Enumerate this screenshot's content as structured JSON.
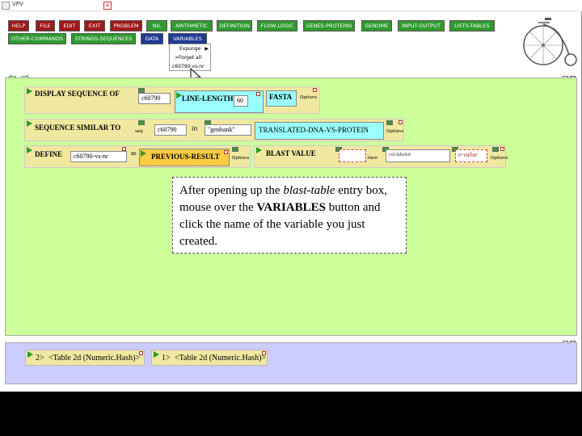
{
  "window": {
    "title": "VPV"
  },
  "menu": {
    "buttons": [
      {
        "label": "HELP",
        "color": "red"
      },
      {
        "label": "FILE",
        "color": "red"
      },
      {
        "label": "EDIT",
        "color": "red"
      },
      {
        "label": "EXIT",
        "color": "red"
      },
      {
        "label": "PROBLEM",
        "color": "red"
      },
      {
        "label": "NIL",
        "color": "green"
      },
      {
        "label": "ARITHMETIC",
        "color": "green"
      },
      {
        "label": "DEFINITION",
        "color": "green"
      },
      {
        "label": "FLOW-LOGIC",
        "color": "green"
      },
      {
        "label": "GENES-PROTEINS",
        "color": "green"
      },
      {
        "label": "GENOME",
        "color": "green"
      },
      {
        "label": "INPUT-OUTPUT",
        "color": "green"
      },
      {
        "label": "LISTS-TABLES",
        "color": "green"
      },
      {
        "label": "OTHER-COMMANDS",
        "color": "green"
      },
      {
        "label": "STRINGS-SEQUENCES",
        "color": "green"
      },
      {
        "label": "DATA",
        "color": "blue"
      },
      {
        "label": "VARIABLES",
        "color": "blue"
      }
    ],
    "colors": {
      "red": "#9e1a1a",
      "green": "#2f9a2f",
      "blue": "#1f3a94"
    }
  },
  "variables_menu": {
    "items": [
      "Expunge",
      "Forget all",
      "c60790-vs-nr"
    ]
  },
  "workspace": {
    "rows": {
      "display": {
        "label": "DISPLAY SEQUENCE OF",
        "arg": "c60790",
        "line_length": "LINE-LENGTH",
        "line_length_value": "60",
        "fasta": "FASTA",
        "options": "Options"
      },
      "similar": {
        "label": "SEQUENCE SIMILAR TO",
        "arg_hint": "seq",
        "arg": "c60790",
        "in": "in",
        "db": "\"genbank\"",
        "translated": "TRANSLATED-DNA-VS-PROTEIN",
        "options": "Options"
      },
      "define": {
        "label": "DEFINE",
        "var": "c60790-vs-nr",
        "eq": "=",
        "value": "PREVIOUS-RESULT",
        "options": "Options",
        "blast": "BLAST VALUE",
        "small": "item",
        "col_hint": "col-labeled",
        "evalue": "e-value",
        "options2": "Options"
      }
    },
    "tooltip": {
      "part1": "After opening up the ",
      "italic": "blast-table",
      "part2": " entry box, mouse over the ",
      "bold": "VARIABLES",
      "part3": " button and click the name of the variable you just created."
    }
  },
  "results": [
    {
      "index": "2>",
      "text": "<Table 2d (Numeric.Hash)>"
    },
    {
      "index": "1>",
      "text": "<Table 2d (Numeric.Hash)>"
    }
  ]
}
